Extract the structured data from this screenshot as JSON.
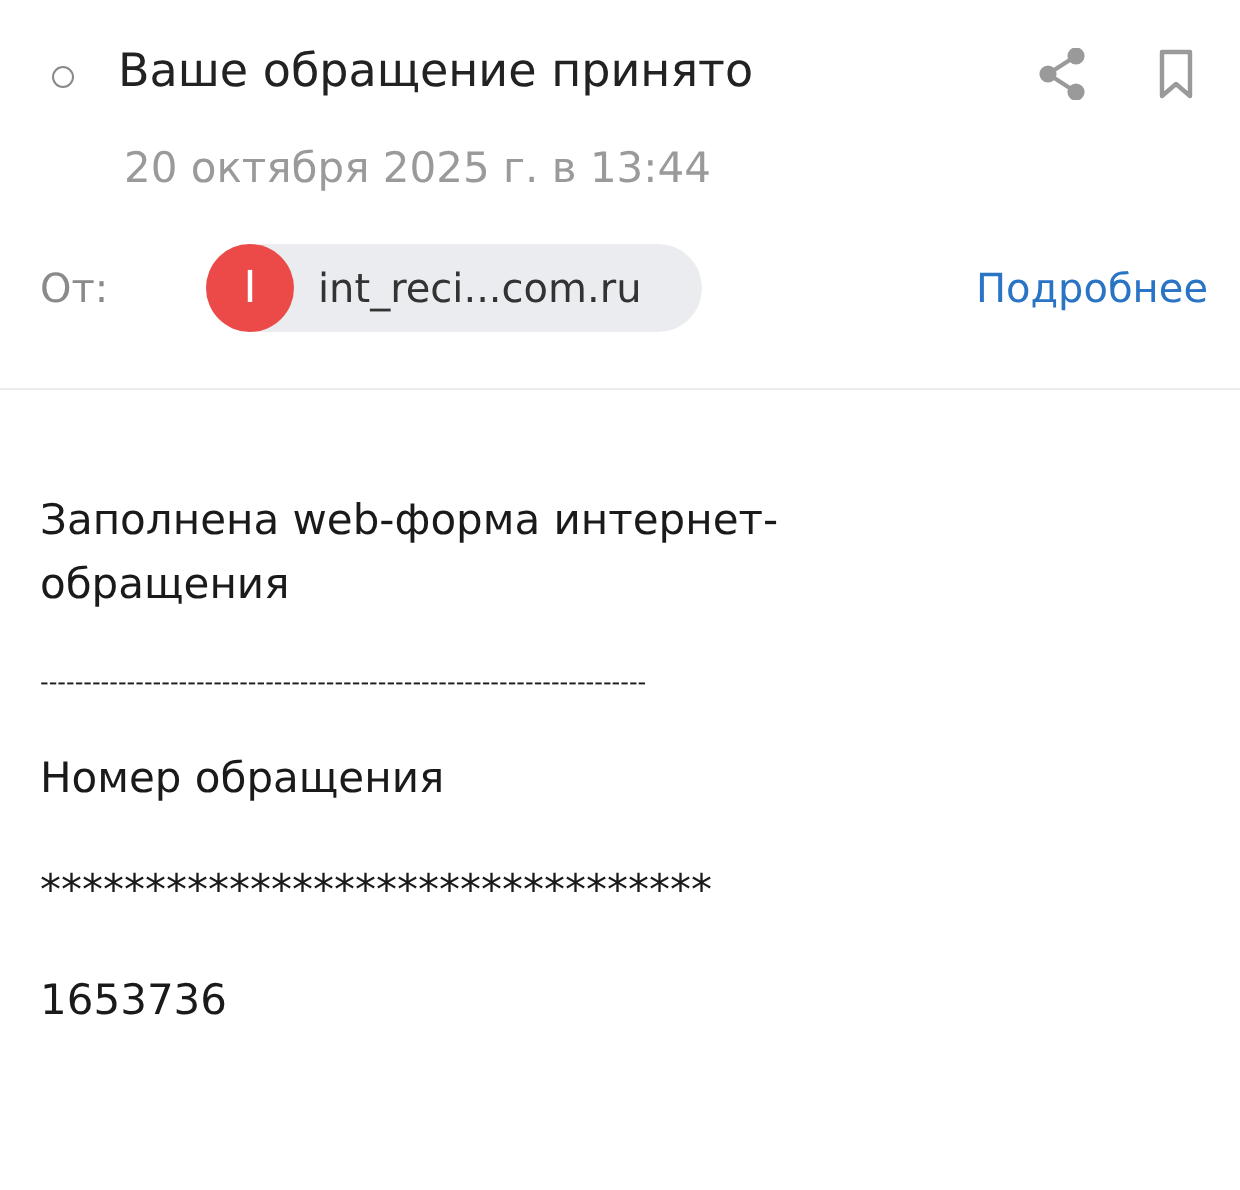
{
  "message": {
    "unread": false,
    "subject": "Ваше обращение принято",
    "date": "20 октября 2025 г. в 13:44",
    "from_label": "От:",
    "sender": {
      "initial": "I",
      "color": "#ec4949",
      "address": "int_reci...com.ru"
    },
    "details_link": "Подробнее"
  },
  "body": [
    "Заполнена web-форма интернет-обращения",
    "----------------------------------------------------------------------",
    "Номер обращения",
    "********************************",
    "1653736"
  ]
}
